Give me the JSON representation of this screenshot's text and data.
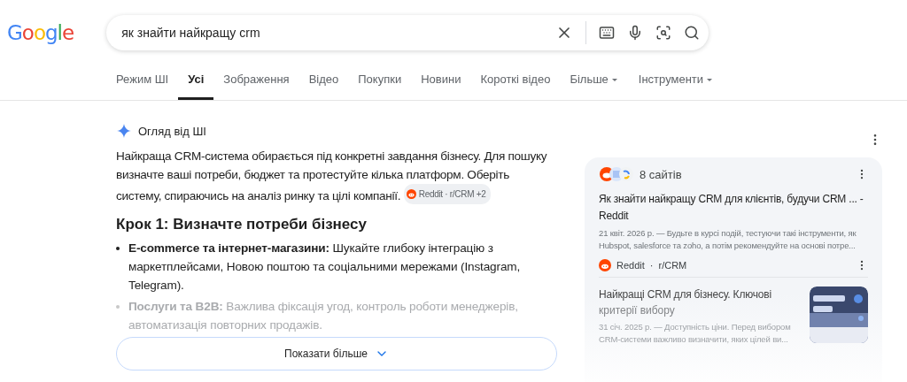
{
  "header": {
    "logo": "Google",
    "search": {
      "value": "як знайти найкращу crm"
    }
  },
  "tabs": [
    {
      "label": "Режим ШІ",
      "selected": false,
      "kind": "plain"
    },
    {
      "label": "Усі",
      "selected": true,
      "kind": "plain"
    },
    {
      "label": "Зображення",
      "selected": false,
      "kind": "plain"
    },
    {
      "label": "Відео",
      "selected": false,
      "kind": "plain"
    },
    {
      "label": "Покупки",
      "selected": false,
      "kind": "plain"
    },
    {
      "label": "Новини",
      "selected": false,
      "kind": "plain"
    },
    {
      "label": "Короткі відео",
      "selected": false,
      "kind": "plain"
    },
    {
      "label": "Більше",
      "selected": false,
      "kind": "menu"
    },
    {
      "label": "Інструменти",
      "selected": false,
      "kind": "menu"
    }
  ],
  "overview": {
    "title": "Огляд від ШІ",
    "paragraph": "Найкраща CRM-система обирається під конкретні завдання бізнесу. Для пошуку визначте ваші потреби, бюджет та протестуйте кілька платформ. Оберіть систему, спираючись на аналіз ринку та цілі компанії.",
    "citation": "Reddit · r/CRM +2",
    "heading": "Крок 1: Визначте потреби бізнесу",
    "bullets": [
      {
        "text": "**E-commerce та інтернет-магазини:** Шукайте глибоку інтеграцію з маркетплейсами, Новою поштою та соціальними мережами (Instagram, Telegram).",
        "faded": false
      },
      {
        "text": "**Послуги та B2B:** Важлива фіксація угод, контроль роботи менеджерів, автоматизація повторних продажів.",
        "faded": true
      }
    ],
    "show_more": "Показати більше"
  },
  "sources": {
    "count": "8 сайтів",
    "items": [
      {
        "title": "Як знайти найкращу CRM для клієнтів, будучи CRM ... - Reddit",
        "snippet": "21 квіт. 2026 р. — Будьте в курсі подій, тестуючи такі інструменти, як Hubspot, salesforce та zoho, а потім рекомендуйте на основі потре...",
        "site": "Reddit",
        "separator": "·",
        "path": "r/CRM",
        "faded": false,
        "kind": "text"
      },
      {
        "title": "Найкращі CRM для бізнесу. Ключові",
        "subtitle": "критерії вибору",
        "snippet": "31 січ. 2025 р. — Доступність ціни. Перед вибором CRM-системи важливо визначити, яких цілей ви...",
        "faded": true,
        "kind": "picture"
      }
    ]
  }
}
